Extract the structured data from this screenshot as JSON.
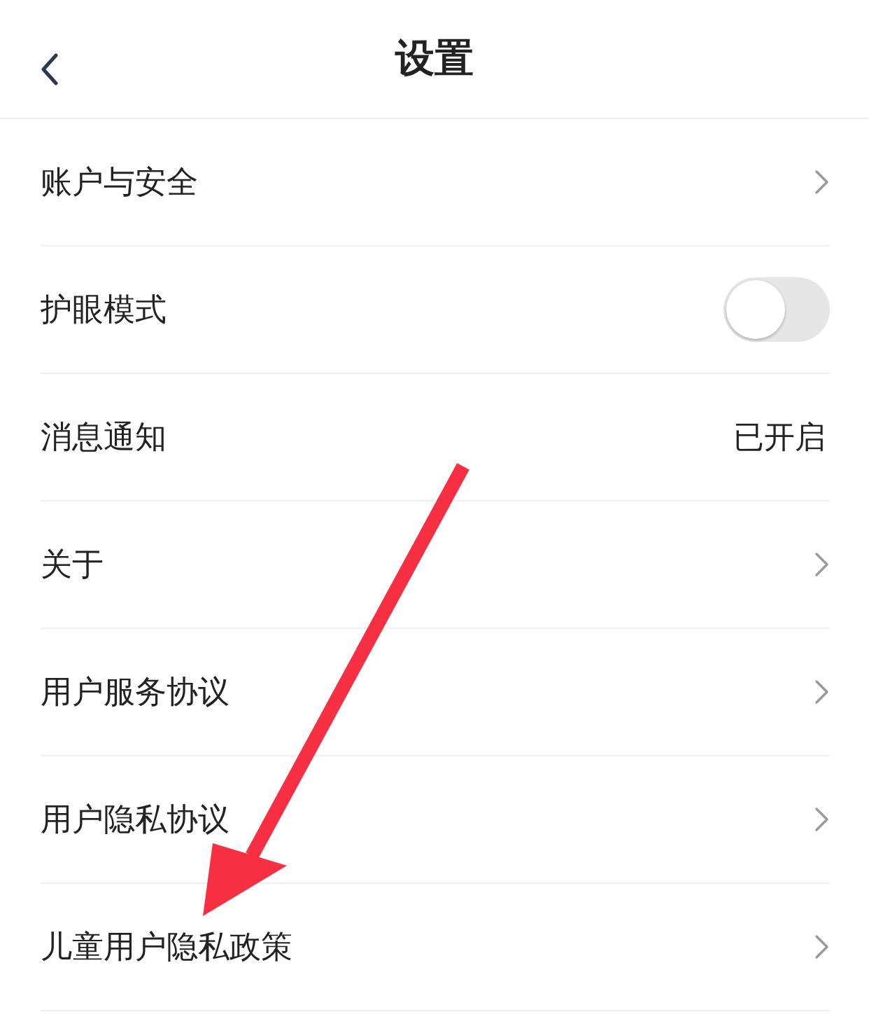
{
  "header": {
    "title": "设置"
  },
  "rows": [
    {
      "kind": "link",
      "label": "账户与安全"
    },
    {
      "kind": "toggle",
      "label": "护眼模式",
      "on": false
    },
    {
      "kind": "value",
      "label": "消息通知",
      "value": "已开启"
    },
    {
      "kind": "link",
      "label": "关于"
    },
    {
      "kind": "link",
      "label": "用户服务协议"
    },
    {
      "kind": "link",
      "label": "用户隐私协议"
    },
    {
      "kind": "link",
      "label": "儿童用户隐私政策"
    }
  ]
}
